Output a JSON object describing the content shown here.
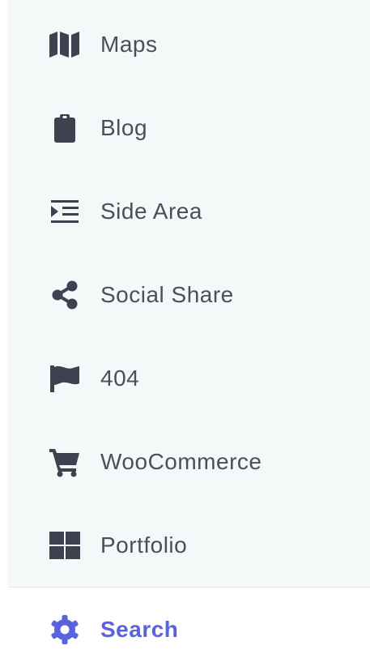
{
  "menu": {
    "items": [
      {
        "label": "Maps",
        "icon": "map-icon"
      },
      {
        "label": "Blog",
        "icon": "clipboard-icon"
      },
      {
        "label": "Side Area",
        "icon": "indent-icon"
      },
      {
        "label": "Social Share",
        "icon": "share-icon"
      },
      {
        "label": "404",
        "icon": "flag-icon"
      },
      {
        "label": "WooCommerce",
        "icon": "cart-icon"
      },
      {
        "label": "Portfolio",
        "icon": "grid-icon"
      }
    ],
    "active_item": {
      "label": "Search",
      "icon": "gear-icon"
    }
  },
  "colors": {
    "menu_background": "#f4f8f9",
    "text": "#4b4f5c",
    "icon": "#3d4150",
    "active": "#5b62dd",
    "divider": "#e1e6ea"
  }
}
